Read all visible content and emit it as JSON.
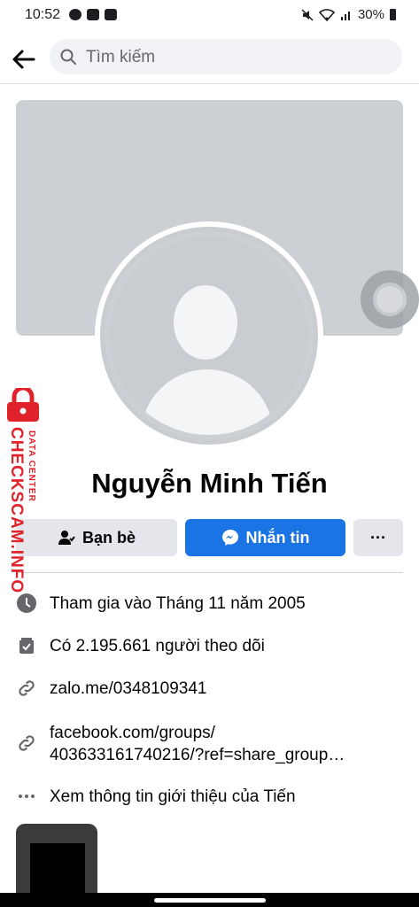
{
  "status_bar": {
    "time": "10:52",
    "battery": "30%"
  },
  "search": {
    "placeholder": "Tìm kiếm"
  },
  "profile": {
    "name": "Nguyễn Minh Tiến"
  },
  "actions": {
    "friends_label": "Bạn bè",
    "message_label": "Nhắn tin",
    "more_label": "···"
  },
  "info": {
    "joined": "Tham gia vào Tháng 11 năm 2005",
    "followers": "Có 2.195.661 người theo dõi",
    "link1": "zalo.me/0348109341",
    "link2_line1": "facebook.com/groups/",
    "link2_line2": "403633161740216/?ref=share_group…",
    "about": "Xem thông tin giới thiệu của Tiến"
  },
  "watermark": {
    "brand": "CHECKSCAM.INFO",
    "sub": "DATA CENTER"
  },
  "colors": {
    "accent": "#1b74e4",
    "watermark": "#e0232b",
    "cover": "#ccd0d5"
  }
}
